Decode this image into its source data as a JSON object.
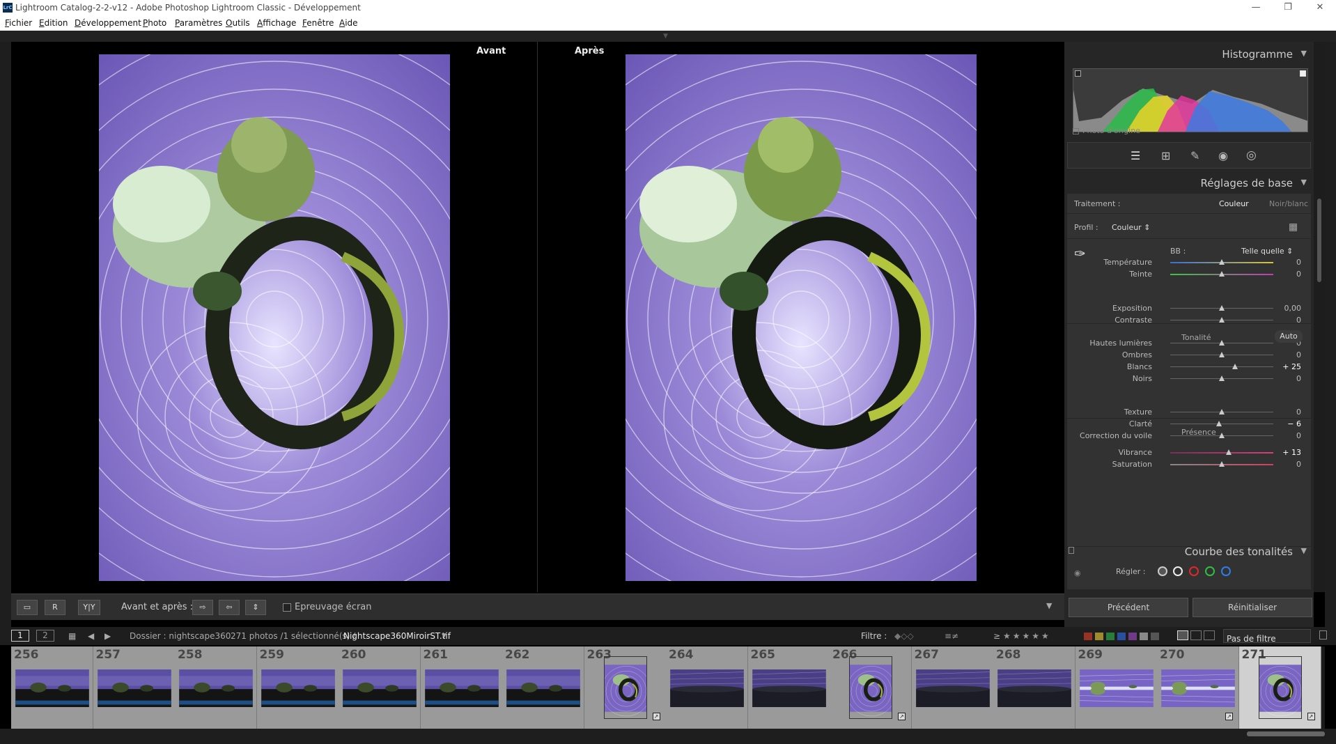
{
  "window": {
    "title": "Lightroom Catalog-2-2-v12 - Adobe Photoshop Lightroom Classic - Développement",
    "app_icon": "LrC"
  },
  "menu": [
    "Fichier",
    "Edition",
    "Développement",
    "Photo",
    "Paramètres",
    "Outils",
    "Affichage",
    "Fenêtre",
    "Aide"
  ],
  "viewer": {
    "before_label": "Avant",
    "after_label": "Après"
  },
  "toolbar": {
    "before_after_label": "Avant et après :",
    "soft_proof_label": "Epreuvage écran",
    "view_mode_label": "Y|Y"
  },
  "histogram": {
    "title": "Histogramme",
    "original_photo_label": "Photo d'origine"
  },
  "basic": {
    "title": "Réglages de base",
    "treatment_label": "Traitement :",
    "treatment_color": "Couleur",
    "treatment_bw": "Noir/blanc",
    "profile_label": "Profil :",
    "profile_value": "Couleur",
    "wb_label": "BB :",
    "wb_value": "Telle quelle",
    "tone_label": "Tonalité",
    "auto_label": "Auto",
    "presence_label": "Présence",
    "sliders": [
      {
        "label": "Température",
        "value": "0",
        "pos": 0.5
      },
      {
        "label": "Teinte",
        "value": "0",
        "pos": 0.5
      },
      {
        "label": "Exposition",
        "value": "0,00",
        "pos": 0.5
      },
      {
        "label": "Contraste",
        "value": "0",
        "pos": 0.5
      },
      {
        "label": "Hautes lumières",
        "value": "0",
        "pos": 0.5
      },
      {
        "label": "Ombres",
        "value": "0",
        "pos": 0.5
      },
      {
        "label": "Blancs",
        "value": "+ 25",
        "pos": 0.625
      },
      {
        "label": "Noirs",
        "value": "0",
        "pos": 0.5
      },
      {
        "label": "Texture",
        "value": "0",
        "pos": 0.5
      },
      {
        "label": "Clarté",
        "value": "− 6",
        "pos": 0.47
      },
      {
        "label": "Correction du voile",
        "value": "0",
        "pos": 0.5
      },
      {
        "label": "Vibrance",
        "value": "+ 13",
        "pos": 0.565
      },
      {
        "label": "Saturation",
        "value": "0",
        "pos": 0.5
      }
    ]
  },
  "tone_curve": {
    "title": "Courbe des tonalités",
    "adjust_label": "Régler :"
  },
  "buttons": {
    "previous": "Précédent",
    "reset": "Réinitialiser"
  },
  "filmstrip_bar": {
    "page1": "1",
    "page2": "2",
    "folder": "Dossier : nightscape360",
    "count": "271 photos /1 sélectionné(s) /",
    "filename": "Nightscape360MiroirST.tif",
    "filter_label": "Filtre :",
    "filter_value": "Pas de filtre",
    "rating_prefix": "≥",
    "colors": {
      "red": "#c0392b",
      "yellow": "#c9b037",
      "green": "#2e9e44",
      "blue": "#2e62c9",
      "purple": "#8e44ad"
    }
  },
  "filmstrip": [
    {
      "num": "256",
      "type": "pano"
    },
    {
      "num": "257",
      "type": "pano"
    },
    {
      "num": "258",
      "type": "pano"
    },
    {
      "num": "259",
      "type": "pano"
    },
    {
      "num": "260",
      "type": "pano"
    },
    {
      "num": "261",
      "type": "pano"
    },
    {
      "num": "262",
      "type": "pano"
    },
    {
      "num": "263",
      "type": "planet",
      "badge": true
    },
    {
      "num": "264",
      "type": "stars"
    },
    {
      "num": "265",
      "type": "stars"
    },
    {
      "num": "266",
      "type": "planet",
      "badge": true
    },
    {
      "num": "267",
      "type": "stars"
    },
    {
      "num": "268",
      "type": "stars"
    },
    {
      "num": "269",
      "type": "mirror"
    },
    {
      "num": "270",
      "type": "mirror",
      "badge": true
    },
    {
      "num": "271",
      "type": "planet",
      "badge": true,
      "selected": true
    }
  ]
}
